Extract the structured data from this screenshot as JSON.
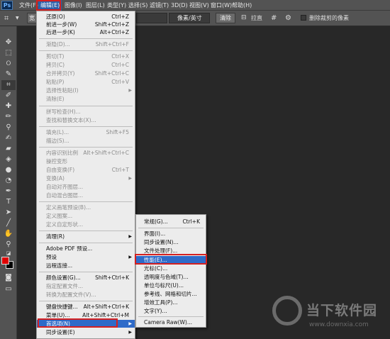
{
  "app": {
    "logo": "Ps"
  },
  "menubar": {
    "items": [
      "文件(F)",
      "编辑(E)",
      "图像(I)",
      "图层(L)",
      "类型(Y)",
      "选择(S)",
      "滤镜(T)",
      "3D(D)",
      "视图(V)",
      "窗口(W)",
      "帮助(H)"
    ]
  },
  "optionsbar": {
    "width_label": "宽",
    "unit_select": "像素/英寸",
    "clear_button": "清除",
    "straighten_label": "拉直",
    "delete_cropped_label": "删除裁剪的像素"
  },
  "edit_menu": {
    "items": [
      {
        "label": "还原(O)",
        "shortcut": "Ctrl+Z"
      },
      {
        "label": "前进一步(W)",
        "shortcut": "Shift+Ctrl+Z"
      },
      {
        "label": "后退一步(K)",
        "shortcut": "Alt+Ctrl+Z"
      },
      {
        "label": "渐隐(D)...",
        "shortcut": "Shift+Ctrl+F"
      },
      {
        "label": "剪切(T)",
        "shortcut": "Ctrl+X"
      },
      {
        "label": "拷贝(C)",
        "shortcut": "Ctrl+C"
      },
      {
        "label": "合并拷贝(Y)",
        "shortcut": "Shift+Ctrl+C"
      },
      {
        "label": "粘贴(P)",
        "shortcut": "Ctrl+V"
      },
      {
        "label": "选择性粘贴(I)",
        "shortcut": ""
      },
      {
        "label": "清除(E)",
        "shortcut": ""
      },
      {
        "label": "拼写检查(H)...",
        "shortcut": ""
      },
      {
        "label": "查找和替换文本(X)...",
        "shortcut": ""
      },
      {
        "label": "填充(L)...",
        "shortcut": "Shift+F5"
      },
      {
        "label": "描边(S)...",
        "shortcut": ""
      },
      {
        "label": "内容识别比例",
        "shortcut": "Alt+Shift+Ctrl+C"
      },
      {
        "label": "操控变形",
        "shortcut": ""
      },
      {
        "label": "自由变换(F)",
        "shortcut": "Ctrl+T"
      },
      {
        "label": "变换(A)",
        "shortcut": ""
      },
      {
        "label": "自动对齐图层...",
        "shortcut": ""
      },
      {
        "label": "自动混合图层...",
        "shortcut": ""
      },
      {
        "label": "定义画笔预设(B)...",
        "shortcut": ""
      },
      {
        "label": "定义图案...",
        "shortcut": ""
      },
      {
        "label": "定义自定形状...",
        "shortcut": ""
      },
      {
        "label": "清理(R)",
        "shortcut": ""
      },
      {
        "label": "Adobe PDF 预设...",
        "shortcut": ""
      },
      {
        "label": "预设",
        "shortcut": ""
      },
      {
        "label": "远程连接...",
        "shortcut": ""
      },
      {
        "label": "颜色设置(G)...",
        "shortcut": "Shift+Ctrl+K"
      },
      {
        "label": "指定配置文件...",
        "shortcut": ""
      },
      {
        "label": "转换为配置文件(V)...",
        "shortcut": ""
      },
      {
        "label": "键盘快捷键...",
        "shortcut": "Alt+Shift+Ctrl+K"
      },
      {
        "label": "菜单(U)...",
        "shortcut": "Alt+Shift+Ctrl+M"
      },
      {
        "label": "首选项(N)",
        "shortcut": ""
      },
      {
        "label": "同步设置(E)",
        "shortcut": ""
      }
    ]
  },
  "preferences_submenu": {
    "items": [
      {
        "label": "常规(G)...",
        "shortcut": "Ctrl+K"
      },
      {
        "label": "界面(I)...",
        "shortcut": ""
      },
      {
        "label": "同步设置(N)...",
        "shortcut": ""
      },
      {
        "label": "文件处理(F)...",
        "shortcut": ""
      },
      {
        "label": "性能(E)...",
        "shortcut": ""
      },
      {
        "label": "光标(C)...",
        "shortcut": ""
      },
      {
        "label": "透明度与色域(T)...",
        "shortcut": ""
      },
      {
        "label": "单位与标尺(U)...",
        "shortcut": ""
      },
      {
        "label": "参考线、网格和切片...",
        "shortcut": ""
      },
      {
        "label": "增效工具(P)...",
        "shortcut": ""
      },
      {
        "label": "文字(Y)...",
        "shortcut": ""
      },
      {
        "label": "Camera Raw(W)...",
        "shortcut": ""
      }
    ]
  },
  "watermark": {
    "title": "当下软件园",
    "url": "www.downxia.com"
  },
  "colors": {
    "foreground": "#e00000",
    "background": "#000000",
    "highlight": "#2e6bc9",
    "annotation": "#d42020"
  }
}
